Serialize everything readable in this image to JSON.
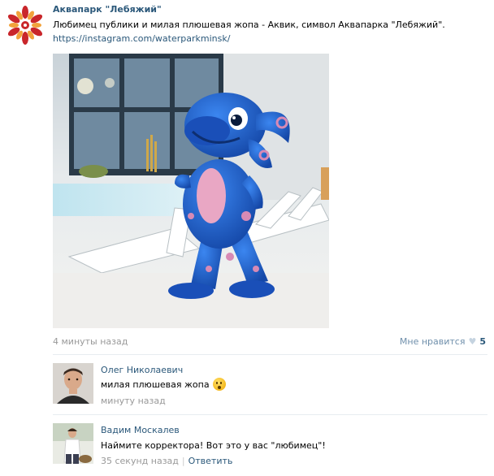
{
  "post": {
    "group_name": "Аквапарк \"Лебяжий\"",
    "text": "Любимец публики и милая плюшевая жопа - Аквик, символ Аквапарка \"Лебяжий\".",
    "link": "https://instagram.com/waterparkminsk/",
    "photo_icon": "mascot-photo",
    "time": "4 минуты назад",
    "like_label": "Мне нравится",
    "like_icon": "heart-icon",
    "like_count": "5"
  },
  "comments": [
    {
      "author": "Олег Николаевич",
      "text": "милая плюшевая жопа",
      "emoji": "astonished-face-emoji",
      "time": "минуту назад"
    },
    {
      "author": "Вадим Москалев",
      "text": "Наймите корректора! Вот это у вас \"любимец\"!",
      "time": "35 секунд назад",
      "reply_label": "Ответить"
    }
  ],
  "colors": {
    "link": "#2b587a",
    "meta": "#999999",
    "mascot": "#1e62c9",
    "logo_red": "#c9262b",
    "logo_orange": "#f2a23b"
  }
}
